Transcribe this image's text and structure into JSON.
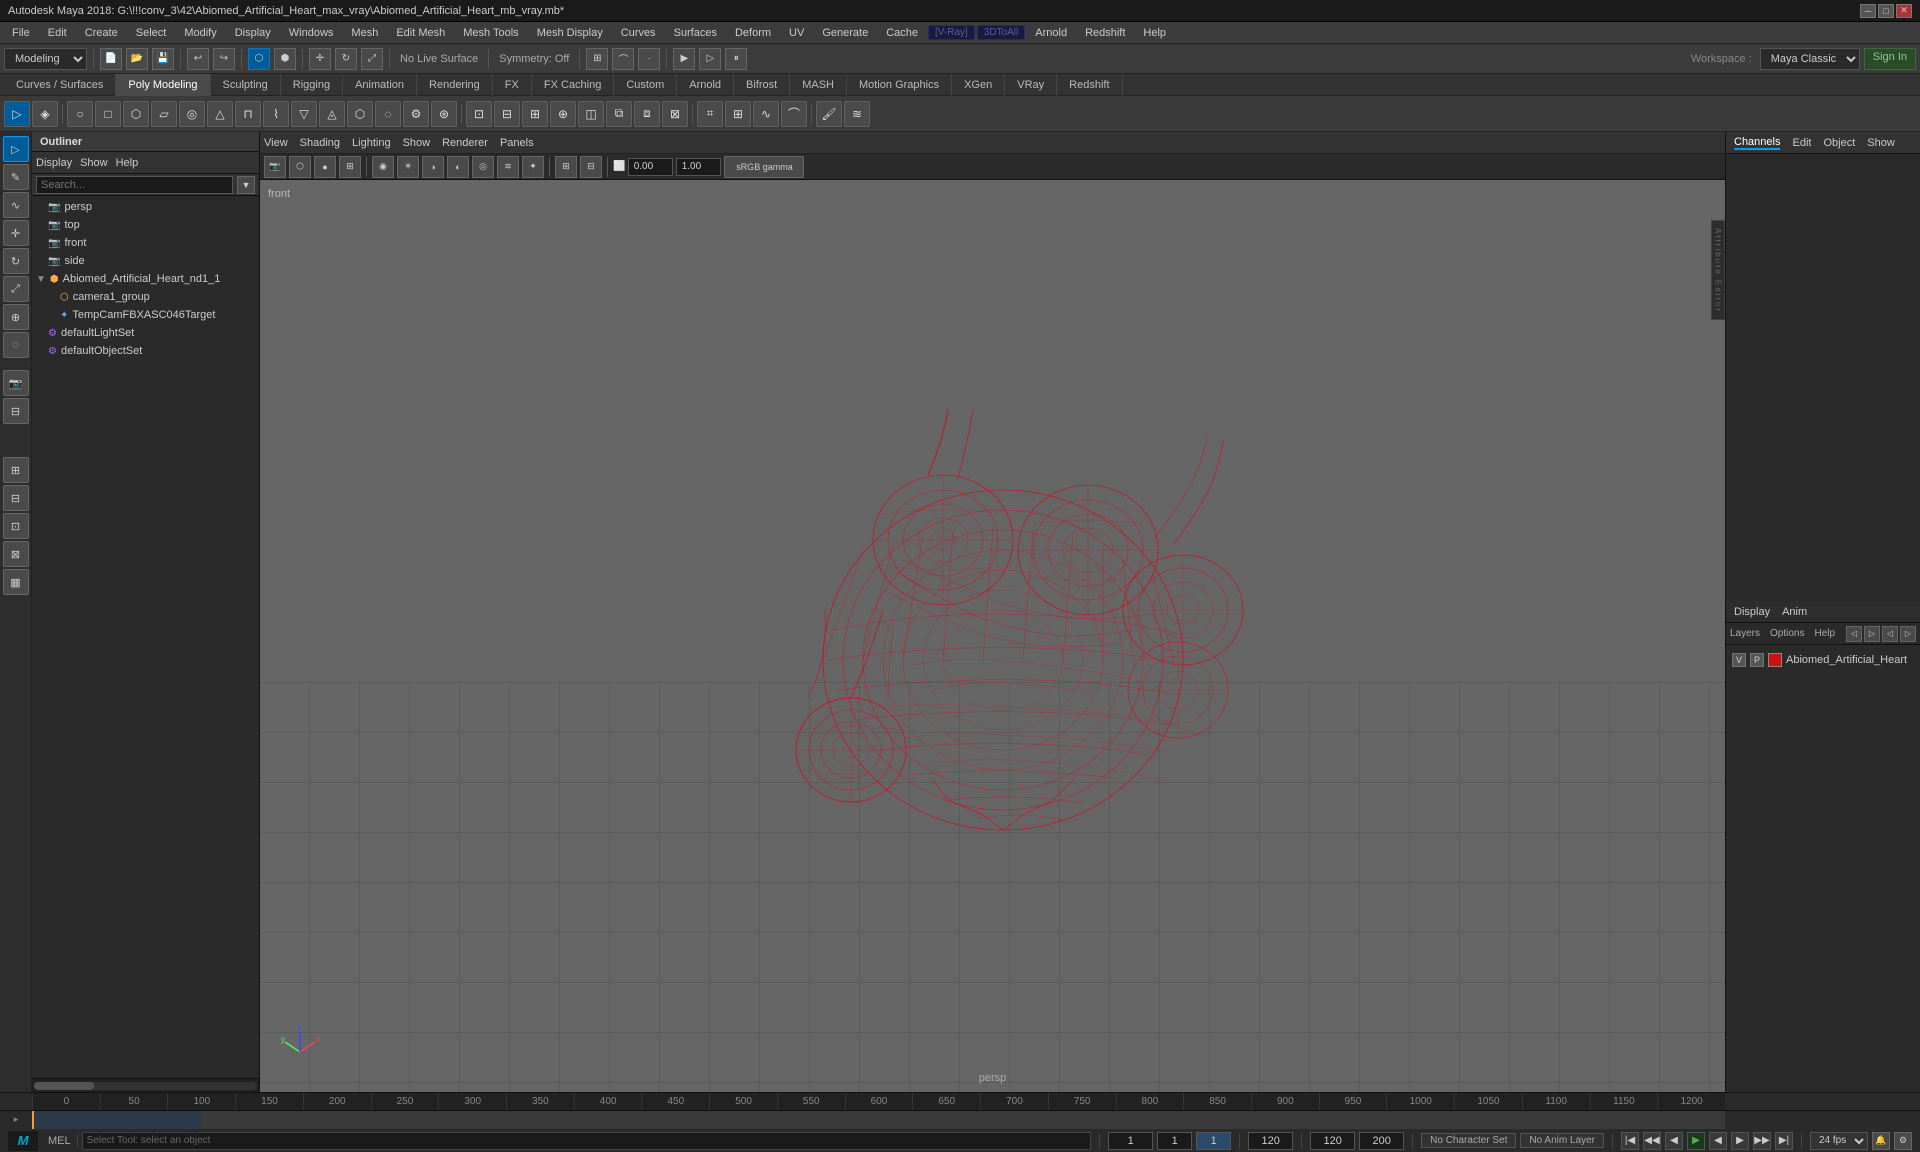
{
  "titlebar": {
    "title": "Autodesk Maya 2018: G:\\!!!conv_3\\42\\Abiomed_Artificial_Heart_max_vray\\Abiomed_Artificial_Heart_mb_vray.mb*",
    "min": "─",
    "max": "□",
    "close": "✕"
  },
  "menubar": {
    "items": [
      "File",
      "Edit",
      "Create",
      "Select",
      "Modify",
      "Display",
      "Windows",
      "Mesh",
      "Edit Mesh",
      "Mesh Tools",
      "Mesh Display",
      "Curves",
      "Surfaces",
      "Deform",
      "UV",
      "Generate",
      "Cache",
      "UV",
      "Arnold",
      "Redshift",
      "Help"
    ]
  },
  "toolbar": {
    "workspace_label": "Workspace :",
    "workspace_value": "Maya Classic",
    "modeling_dropdown": "Modeling",
    "no_live_surface": "No Live Surface",
    "symmetry": "Symmetry: Off",
    "sign_in": "Sign In"
  },
  "tabs1": {
    "items": [
      "Curves / Surfaces",
      "Poly Modeling",
      "Sculpting",
      "Rigging",
      "Animation",
      "Rendering",
      "FX",
      "FX Caching",
      "Custom",
      "Arnold",
      "Bifrost",
      "MASH",
      "Motion Graphics",
      "XGen",
      "VRay",
      "Redshift"
    ]
  },
  "tabs2": {
    "active": "Poly Modeling"
  },
  "viewport": {
    "menu_items": [
      "View",
      "Shading",
      "Lighting",
      "Show",
      "Renderer",
      "Panels"
    ],
    "view_label": "front",
    "camera_label": "persp",
    "gamma_label": "sRGB gamma",
    "values": [
      "0.00",
      "1.00"
    ]
  },
  "outliner": {
    "title": "Outliner",
    "toolbar": [
      "Display",
      "Show",
      "Help"
    ],
    "search_placeholder": "Search...",
    "items": [
      {
        "label": "persp",
        "type": "camera",
        "indent": 1
      },
      {
        "label": "top",
        "type": "camera",
        "indent": 1
      },
      {
        "label": "front",
        "type": "camera",
        "indent": 1
      },
      {
        "label": "side",
        "type": "camera",
        "indent": 1
      },
      {
        "label": "Abiomed_Artificial_Heart_nd1_1",
        "type": "group",
        "indent": 0
      },
      {
        "label": "camera1_group",
        "type": "group",
        "indent": 2
      },
      {
        "label": "TempCamFBXASC046Target",
        "type": "target",
        "indent": 2
      },
      {
        "label": "defaultLightSet",
        "type": "set",
        "indent": 1
      },
      {
        "label": "defaultObjectSet",
        "type": "set",
        "indent": 1
      }
    ]
  },
  "right_panel": {
    "tabs": [
      "Channels",
      "Edit",
      "Object",
      "Show"
    ],
    "sub_tabs": [
      "Display",
      "Anim"
    ],
    "layer_tabs": [
      "Layers",
      "Options",
      "Help"
    ],
    "layer_item": {
      "v": "V",
      "p": "P",
      "name": "Abiomed_Artificial_Heart"
    }
  },
  "timeline": {
    "marks": [
      "0",
      "50",
      "100",
      "150",
      "200",
      "250",
      "300",
      "350",
      "400",
      "450",
      "500",
      "550",
      "600",
      "650",
      "700",
      "750",
      "800",
      "850",
      "900",
      "950",
      "1000",
      "1050",
      "1100",
      "1150",
      "1200"
    ],
    "start_frame": "1",
    "end_frame": "120",
    "current_frame": "1",
    "range_end": "120",
    "max_frame": "200",
    "fps": "24 fps"
  },
  "statusbar": {
    "mel_label": "MEL",
    "help_text": "Select Tool: select an object",
    "no_character_set": "No Character Set",
    "no_anim_layer": "No Anim Layer",
    "fps": "24 fps"
  },
  "colors": {
    "heart_red": "#cc1122",
    "active_blue": "#005b99",
    "viewport_bg": "#656565"
  }
}
